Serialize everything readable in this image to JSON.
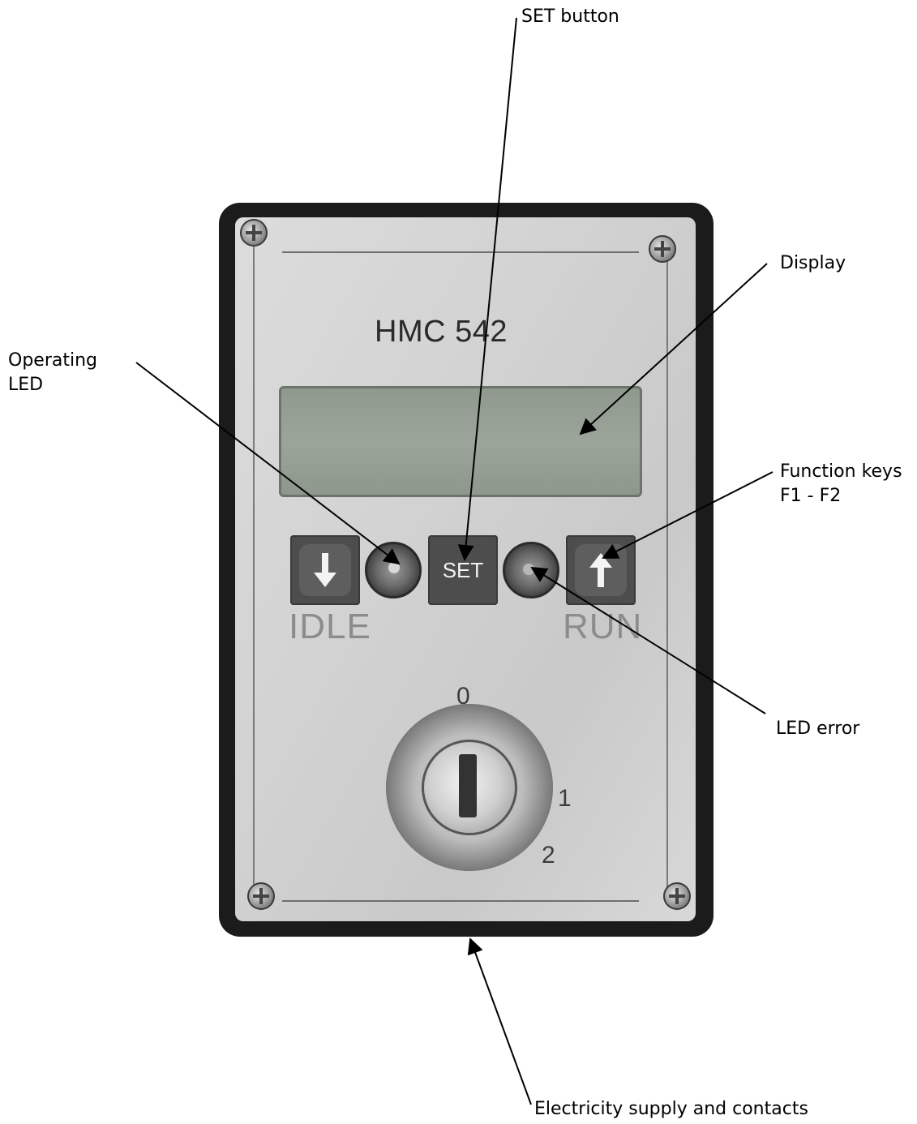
{
  "device": {
    "model": "HMC 542",
    "key_labels": {
      "set": "SET"
    },
    "panel_labels": {
      "idle": "IDLE",
      "run": "RUN"
    },
    "switch_positions": [
      "0",
      "1",
      "2"
    ]
  },
  "callouts": {
    "set_button": "SET button",
    "display": "Display",
    "operating_led": "Operating\nLED",
    "function_keys": "Function keys\nF1 - F2",
    "led_error": "LED error",
    "electricity": "Electricity supply and contacts"
  },
  "icons": {
    "down_key": "arrow-down-icon",
    "up_key": "arrow-up-icon"
  }
}
